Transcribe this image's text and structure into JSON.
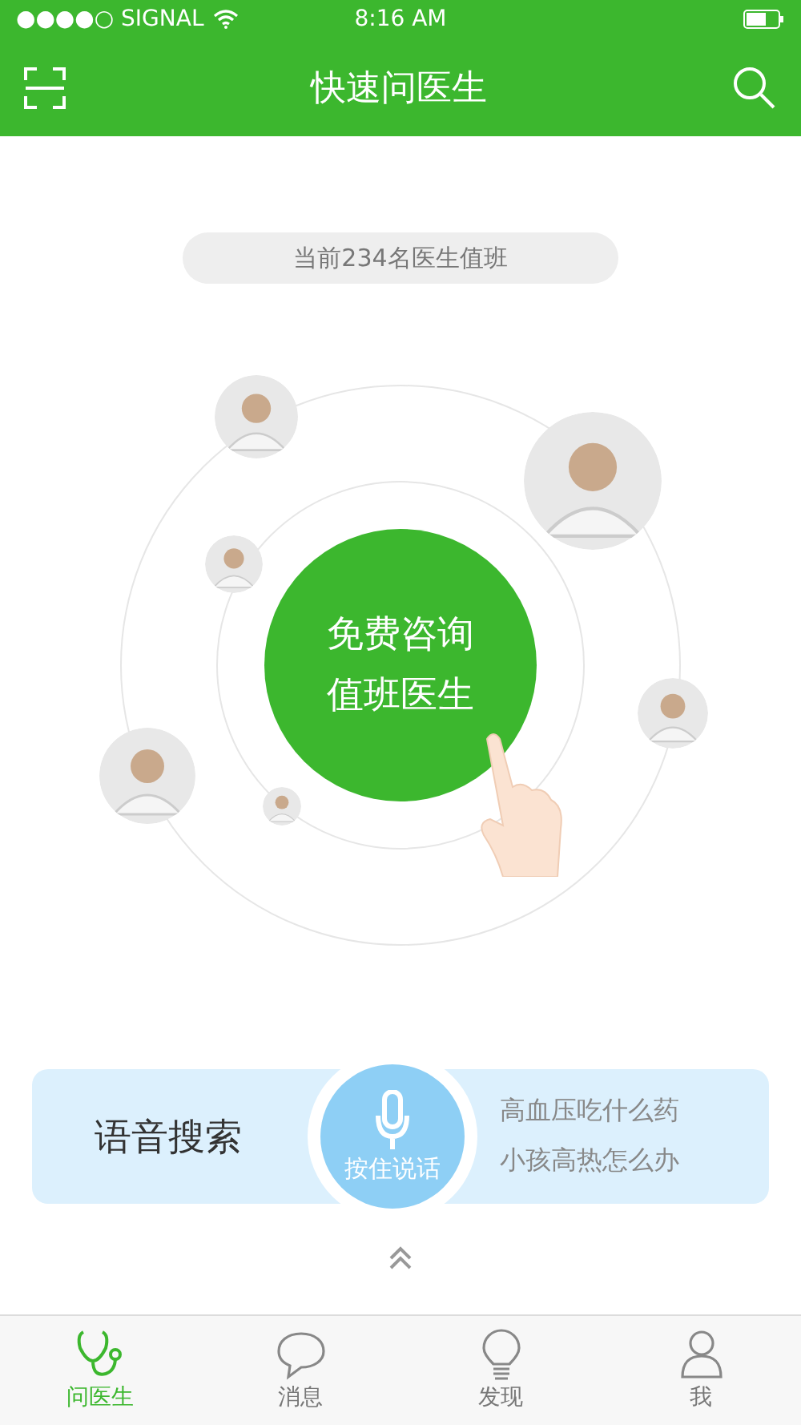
{
  "status_bar": {
    "carrier": "●●●●○ SIGNAL",
    "time": "8:16 AM"
  },
  "nav_bar": {
    "title": "快速问医生"
  },
  "on_duty": {
    "text": "当前234名医生值班"
  },
  "consult_button": {
    "lines": [
      "免费咨询",
      "值班医生"
    ]
  },
  "voice_search": {
    "label": "语音搜索",
    "button": "按住说话",
    "examples": [
      "高血压吃什么药",
      "小孩高热怎么办"
    ]
  },
  "tabs": [
    {
      "label": "问医生",
      "kind": "stethoscope",
      "selected": true
    },
    {
      "label": "消息",
      "kind": "chat",
      "selected": false
    },
    {
      "label": "发现",
      "kind": "bulb",
      "selected": false
    },
    {
      "label": "我",
      "kind": "person",
      "selected": false
    }
  ]
}
